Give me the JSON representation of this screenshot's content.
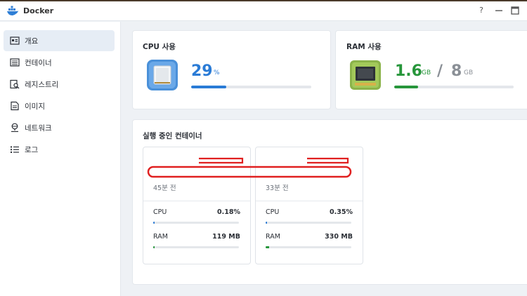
{
  "window": {
    "title": "Docker",
    "help_label": "?"
  },
  "sidebar": {
    "items": [
      {
        "label": "개요",
        "icon": "overview-icon",
        "active": true
      },
      {
        "label": "컨테이너",
        "icon": "container-icon",
        "active": false
      },
      {
        "label": "레지스트리",
        "icon": "registry-icon",
        "active": false
      },
      {
        "label": "이미지",
        "icon": "image-icon",
        "active": false
      },
      {
        "label": "네트워크",
        "icon": "network-icon",
        "active": false
      },
      {
        "label": "로그",
        "icon": "log-icon",
        "active": false
      }
    ]
  },
  "cpu": {
    "title": "CPU 사용",
    "value": "29",
    "unit": "%",
    "usage_fraction": 0.29,
    "color": "#2a7bd6"
  },
  "ram": {
    "title": "RAM 사용",
    "used": "1.6",
    "used_unit": "GB",
    "separator": "/",
    "total": "8",
    "total_unit": "GB",
    "usage_fraction": 0.2,
    "color": "#27963b"
  },
  "running": {
    "title": "실행 중인 컨테이너",
    "containers": [
      {
        "time": "45분 전",
        "cpu_label": "CPU",
        "cpu_value": "0.18%",
        "cpu_fraction": 0.02,
        "ram_label": "RAM",
        "ram_value": "119 MB",
        "ram_fraction": 0.02
      },
      {
        "time": "33분 전",
        "cpu_label": "CPU",
        "cpu_value": "0.35%",
        "cpu_fraction": 0.02,
        "ram_label": "RAM",
        "ram_value": "330 MB",
        "ram_fraction": 0.04
      }
    ]
  }
}
